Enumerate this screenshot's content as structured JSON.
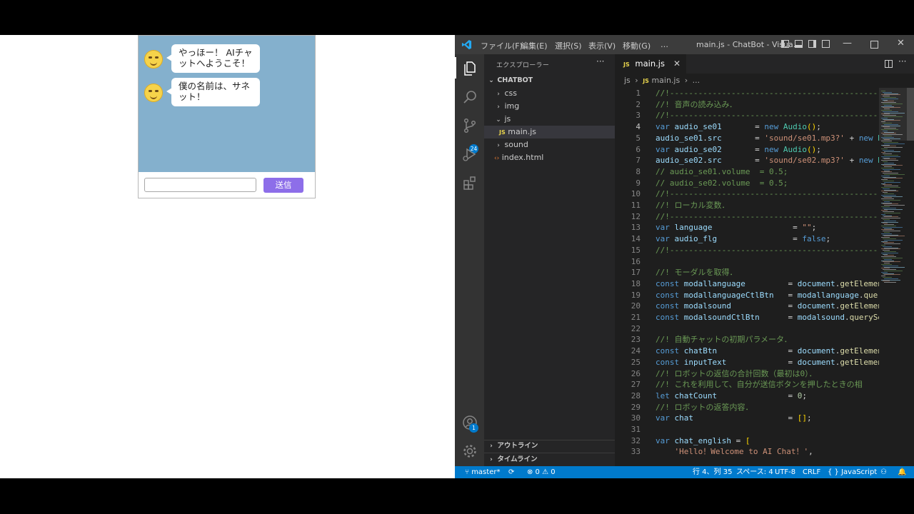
{
  "chat": {
    "messages": [
      "やっほー！ AIチャットへようこそ！",
      "僕の名前は、サネット！"
    ],
    "send_label": "送信",
    "input_value": ""
  },
  "vscode": {
    "menus": [
      "ファイル(F)",
      "編集(E)",
      "選択(S)",
      "表示(V)",
      "移動(G)",
      "…"
    ],
    "window_title": "main.js - ChatBot - Visua...",
    "explorer_title": "エクスプローラー",
    "project": "CHATBOT",
    "tree": [
      {
        "label": "css",
        "type": "folder",
        "chevron": "›"
      },
      {
        "label": "img",
        "type": "folder",
        "chevron": "›"
      },
      {
        "label": "js",
        "type": "folder",
        "chevron": "⌄"
      },
      {
        "label": "main.js",
        "type": "js"
      },
      {
        "label": "sound",
        "type": "folder",
        "chevron": "›"
      },
      {
        "label": "index.html",
        "type": "html"
      }
    ],
    "panels": [
      "アウトライン",
      "タイムライン"
    ],
    "tab_label": "main.js",
    "breadcrumb": [
      "js",
      "main.js",
      "..."
    ],
    "source_control_badge": "24",
    "accounts_badge": "1",
    "code_lines": [
      {
        "n": "1",
        "html": "<span class=\"c\">//!------------------------------------------------</span>"
      },
      {
        "n": "2",
        "html": "<span class=\"c\">//! 音声の読み込み．</span>"
      },
      {
        "n": "3",
        "html": "<span class=\"c\">//!------------------------------------------------</span>"
      },
      {
        "n": "4",
        "html": "<span class=\"k\">var</span> <span class=\"v\">audio_se01</span>       <span class=\"p\">=</span> <span class=\"k\">new</span> <span class=\"t\">Audio</span><span class=\"y\">()</span><span class=\"p\">;</span>"
      },
      {
        "n": "5",
        "html": "<span class=\"v\">audio_se01</span><span class=\"p\">.</span><span class=\"v\">src</span>       <span class=\"p\">=</span> <span class=\"s\">'sound/se01.mp3?'</span> <span class=\"p\">+</span> <span class=\"k\">new</span> <span class=\"t\">Dat</span>"
      },
      {
        "n": "6",
        "html": "<span class=\"k\">var</span> <span class=\"v\">audio_se02</span>       <span class=\"p\">=</span> <span class=\"k\">new</span> <span class=\"t\">Audio</span><span class=\"y\">()</span><span class=\"p\">;</span>"
      },
      {
        "n": "7",
        "html": "<span class=\"v\">audio_se02</span><span class=\"p\">.</span><span class=\"v\">src</span>       <span class=\"p\">=</span> <span class=\"s\">'sound/se02.mp3?'</span> <span class=\"p\">+</span> <span class=\"k\">new</span> <span class=\"t\">Dat</span>"
      },
      {
        "n": "8",
        "html": "<span class=\"c\">// audio_se01.volume  = 0.5;</span>"
      },
      {
        "n": "9",
        "html": "<span class=\"c\">// audio_se02.volume  = 0.5;</span>"
      },
      {
        "n": "10",
        "html": "<span class=\"c\">//!------------------------------------------------</span>"
      },
      {
        "n": "11",
        "html": "<span class=\"c\">//! ローカル変数．</span>"
      },
      {
        "n": "12",
        "html": "<span class=\"c\">//!------------------------------------------------</span>"
      },
      {
        "n": "13",
        "html": "<span class=\"k\">var</span> <span class=\"v\">language</span>                 <span class=\"p\">=</span> <span class=\"s\">\"\"</span><span class=\"p\">;</span>"
      },
      {
        "n": "14",
        "html": "<span class=\"k\">var</span> <span class=\"v\">audio_flg</span>                <span class=\"p\">=</span> <span class=\"k\">false</span><span class=\"p\">;</span>"
      },
      {
        "n": "15",
        "html": "<span class=\"c\">//!------------------------------------------------</span>"
      },
      {
        "n": "16",
        "html": ""
      },
      {
        "n": "17",
        "html": "<span class=\"c\">//! モーダルを取得．</span>"
      },
      {
        "n": "18",
        "html": "<span class=\"k\">const</span> <span class=\"v\">modallanguage</span>         <span class=\"p\">=</span> <span class=\"v\">document</span><span class=\"p\">.</span><span class=\"f\">getElement</span>"
      },
      {
        "n": "19",
        "html": "<span class=\"k\">const</span> <span class=\"v\">modallanguageCtlBtn</span>   <span class=\"p\">=</span> <span class=\"v\">modallanguage</span><span class=\"p\">.</span><span class=\"f\">query</span>"
      },
      {
        "n": "20",
        "html": "<span class=\"k\">const</span> <span class=\"v\">modalsound</span>            <span class=\"p\">=</span> <span class=\"v\">document</span><span class=\"p\">.</span><span class=\"f\">getElement</span>"
      },
      {
        "n": "21",
        "html": "<span class=\"k\">const</span> <span class=\"v\">modalsoundCtlBtn</span>      <span class=\"p\">=</span> <span class=\"v\">modalsound</span><span class=\"p\">.</span><span class=\"f\">querySel</span>"
      },
      {
        "n": "22",
        "html": ""
      },
      {
        "n": "23",
        "html": "<span class=\"c\">//! 自動チャットの初期パラメータ．</span>"
      },
      {
        "n": "24",
        "html": "<span class=\"k\">const</span> <span class=\"v\">chatBtn</span>               <span class=\"p\">=</span> <span class=\"v\">document</span><span class=\"p\">.</span><span class=\"f\">getElement</span>"
      },
      {
        "n": "25",
        "html": "<span class=\"k\">const</span> <span class=\"v\">inputText</span>             <span class=\"p\">=</span> <span class=\"v\">document</span><span class=\"p\">.</span><span class=\"f\">getElement</span>"
      },
      {
        "n": "26",
        "html": "<span class=\"c\">//! ロボットの返信の合計回数（最初は0）．</span>"
      },
      {
        "n": "27",
        "html": "<span class=\"c\">//! これを利用して、自分が送信ボタンを押したときの相</span>"
      },
      {
        "n": "28",
        "html": "<span class=\"k\">let</span> <span class=\"v\">chatCount</span>               <span class=\"p\">=</span> <span class=\"n\">0</span><span class=\"p\">;</span>"
      },
      {
        "n": "29",
        "html": "<span class=\"c\">//! ロボットの返答内容．</span>"
      },
      {
        "n": "30",
        "html": "<span class=\"k\">var</span> <span class=\"v\">chat</span>                    <span class=\"p\">=</span> <span class=\"y\">[]</span><span class=\"p\">;</span>"
      },
      {
        "n": "31",
        "html": ""
      },
      {
        "n": "32",
        "html": "<span class=\"k\">var</span> <span class=\"v\">chat_english</span> <span class=\"p\">=</span> <span class=\"y\">[</span>"
      },
      {
        "n": "33",
        "html": "    <span class=\"s\">'Hello！Welcome to AI Chat！'</span><span class=\"p\">,</span>"
      }
    ],
    "status": {
      "branch": "master*",
      "problems": "⊗ 0 ⚠ 0",
      "position": "行 4、列 35",
      "spaces": "スペース: 4",
      "encoding": "UTF-8",
      "eol": "CRLF",
      "language": "{ } JavaScript"
    }
  }
}
